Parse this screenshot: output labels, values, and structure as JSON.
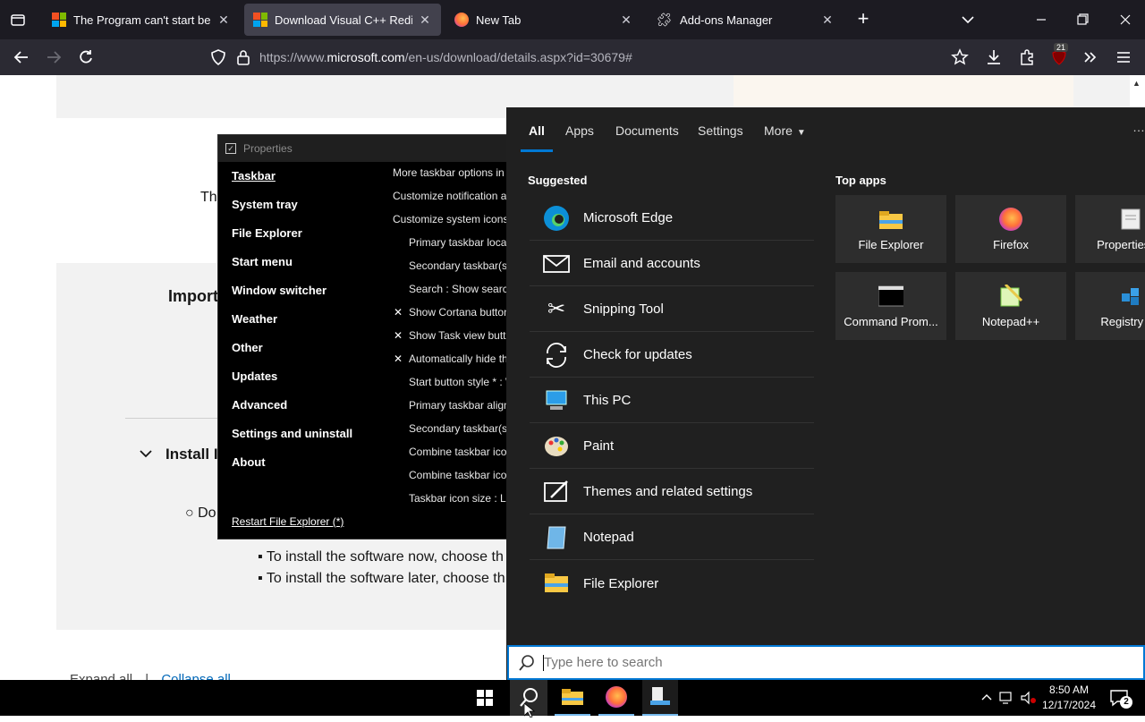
{
  "browser": {
    "tabs": [
      {
        "title": "The Program can't start because"
      },
      {
        "title": "Download Visual C++ Redistrib"
      },
      {
        "title": "New Tab"
      },
      {
        "title": "Add-ons Manager"
      }
    ],
    "url_prefix": "https://www.",
    "url_host": "microsoft.com",
    "url_path": "/en-us/download/details.aspx?id=30679#",
    "extension_badge": "21"
  },
  "page": {
    "text_the": "The",
    "text_import": "Import",
    "install_heading": "Install I",
    "do_text": "Do",
    "bullet1": "To install the software now, choose th",
    "bullet2": "To install the software later, choose th",
    "footer_expand": "Expand all",
    "footer_sep": "|",
    "footer_collapse": "Collapse all"
  },
  "properties": {
    "title": "Properties",
    "categories": [
      "Taskbar",
      "System tray",
      "File Explorer",
      "Start menu",
      "Window switcher",
      "Weather",
      "Other",
      "Updates",
      "Advanced",
      "Settings and uninstall",
      "About"
    ],
    "restart_link": "Restart File Explorer (*)",
    "options": [
      "More taskbar options in",
      "Customize notification a",
      "Customize system icons",
      "Primary taskbar locat",
      "Secondary taskbar(s)",
      "Search : Show search",
      "Show Cortana button",
      "Show Task view butto",
      "Automatically hide th",
      "Start button style * : W",
      "Primary taskbar align",
      "Secondary taskbar(s)",
      "Combine taskbar ico",
      "Combine taskbar ico",
      "Taskbar icon size : La"
    ]
  },
  "search": {
    "tabs": [
      "All",
      "Apps",
      "Documents",
      "Settings",
      "More"
    ],
    "suggested_label": "Suggested",
    "suggested": [
      "Microsoft Edge",
      "Email and accounts",
      "Snipping Tool",
      "Check for updates",
      "This PC",
      "Paint",
      "Themes and related settings",
      "Notepad",
      "File Explorer"
    ],
    "top_apps_label": "Top apps",
    "top_apps": [
      "File Explorer",
      "Firefox",
      "Properties (E",
      "Command Prom...",
      "Notepad++",
      "Registry Ed"
    ],
    "placeholder": "Type here to search"
  },
  "taskbar": {
    "time": "8:50 AM",
    "date": "12/17/2024",
    "notif_count": "2"
  }
}
